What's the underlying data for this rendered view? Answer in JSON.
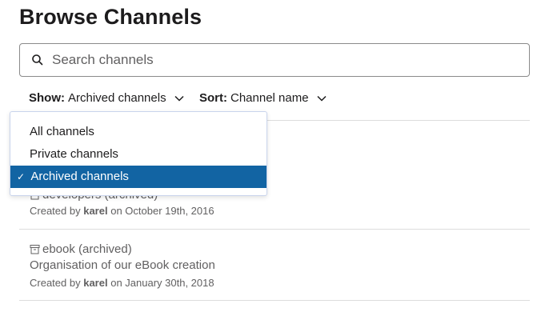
{
  "page": {
    "title": "Browse Channels"
  },
  "search": {
    "placeholder": "Search channels",
    "value": ""
  },
  "filters": {
    "show_key": "Show:",
    "show_value": "Archived channels",
    "sort_key": "Sort:",
    "sort_value": "Channel name"
  },
  "dropdown": {
    "items": [
      {
        "label": "All channels",
        "selected": false
      },
      {
        "label": "Private channels",
        "selected": false
      },
      {
        "label": "Archived channels",
        "selected": true
      }
    ],
    "check_glyph": "✓"
  },
  "channels": [
    {
      "name": "developers (archived)",
      "description": "",
      "created_prefix": "Created by",
      "creator": "karel",
      "created_suffix": "on October 19th, 2016"
    },
    {
      "name": "ebook (archived)",
      "description": "Organisation of our eBook creation",
      "created_prefix": "Created by",
      "creator": "karel",
      "created_suffix": "on January 30th, 2018"
    }
  ],
  "icons": {
    "search": "search-icon",
    "chevron": "chevron-down-icon",
    "archive": "archive-icon",
    "check": "check-icon"
  },
  "colors": {
    "selected_bg": "#1264a3",
    "muted_text": "#616061",
    "border": "#8a8a8a"
  }
}
